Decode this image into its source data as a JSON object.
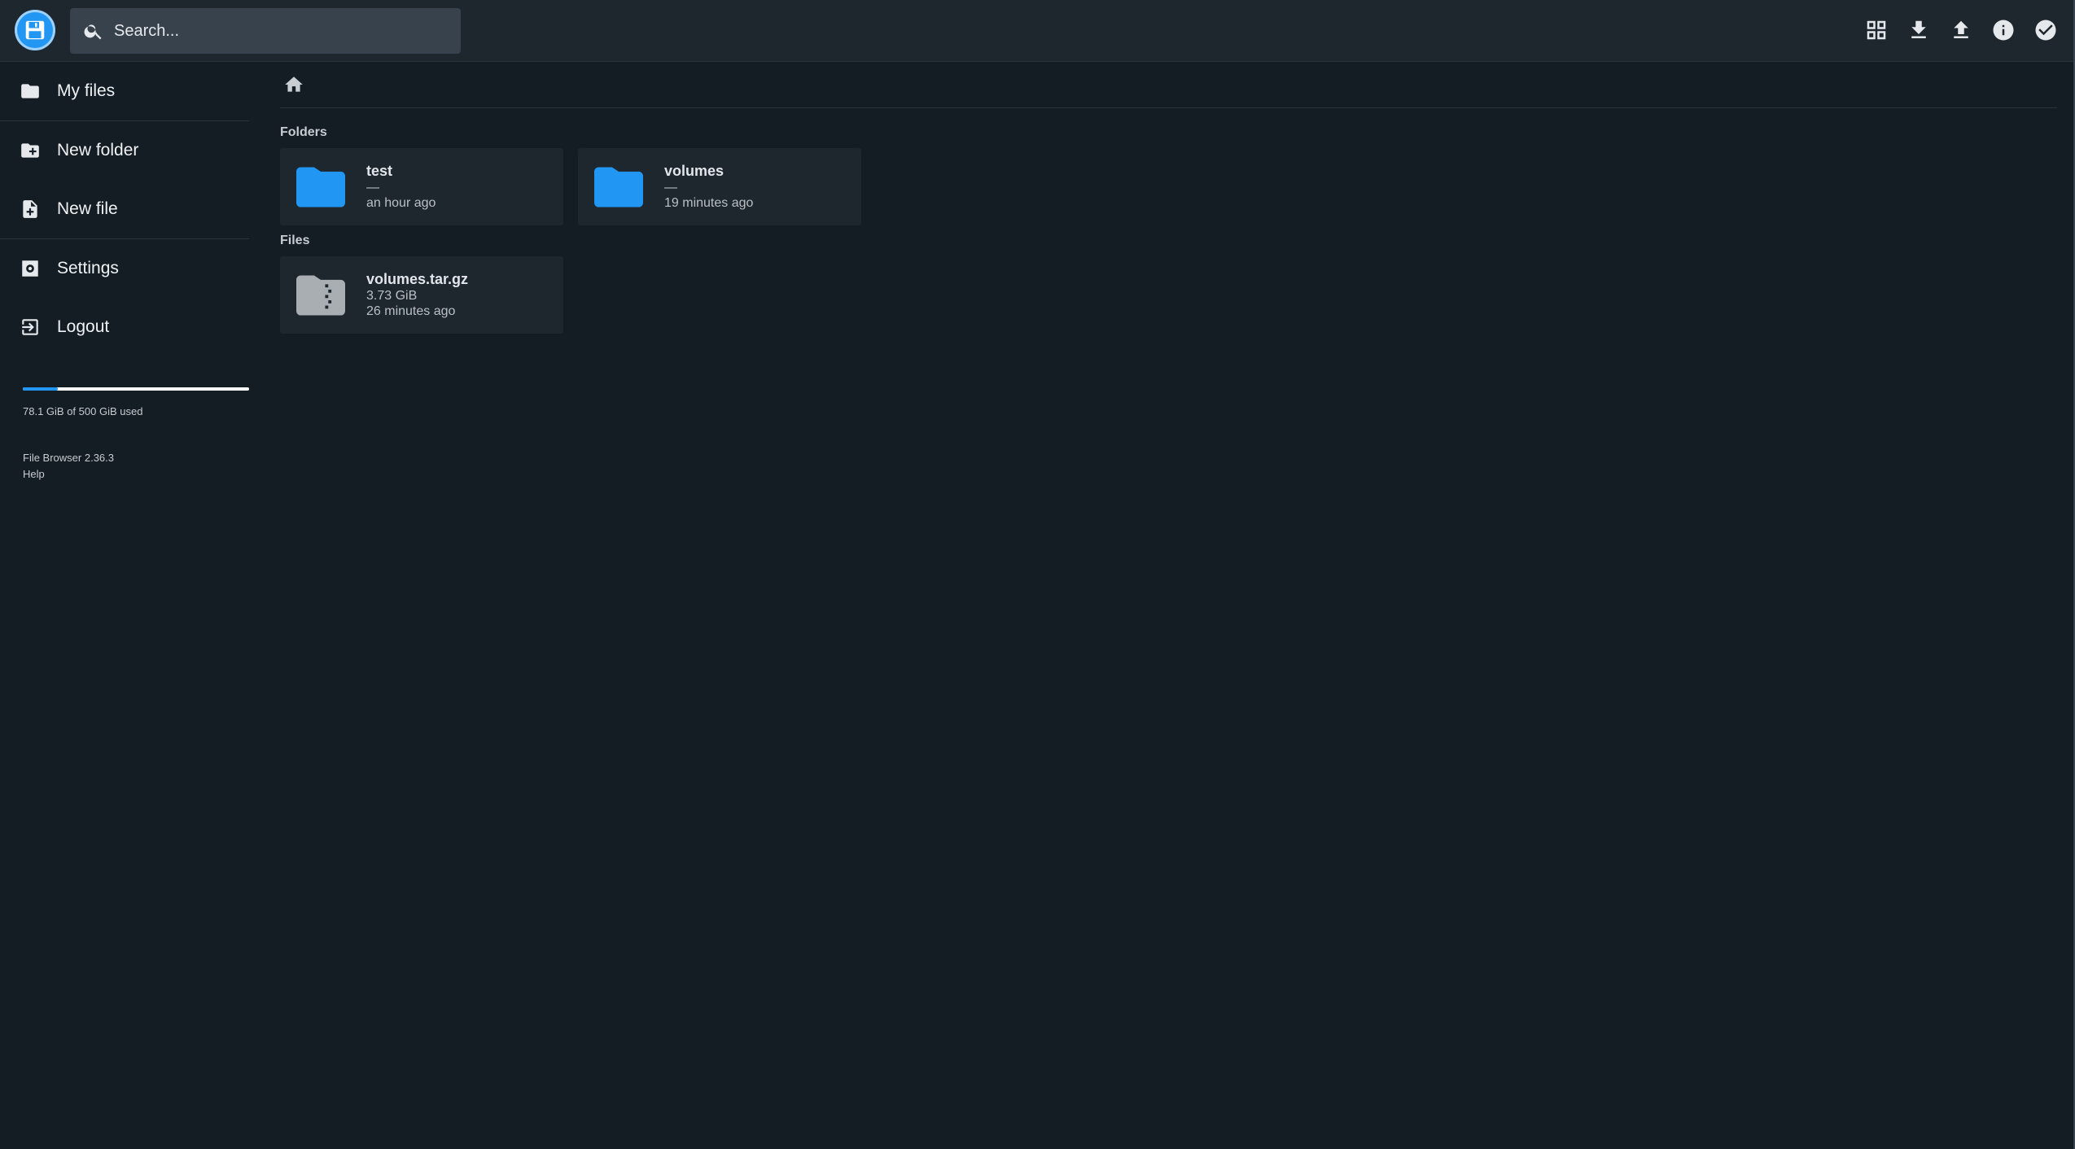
{
  "header": {
    "search_placeholder": "Search...",
    "actions": [
      {
        "name": "view-grid-icon"
      },
      {
        "name": "download-icon"
      },
      {
        "name": "upload-icon"
      },
      {
        "name": "info-icon"
      },
      {
        "name": "select-check-icon"
      }
    ]
  },
  "sidebar": {
    "items": [
      {
        "label": "My files",
        "icon": "folder-icon"
      },
      {
        "label": "New folder",
        "icon": "new-folder-icon"
      },
      {
        "label": "New file",
        "icon": "new-file-icon"
      },
      {
        "label": "Settings",
        "icon": "settings-icon"
      },
      {
        "label": "Logout",
        "icon": "logout-icon"
      }
    ],
    "quota": {
      "text": "78.1 GiB of 500 GiB used",
      "fraction": 0.156
    },
    "version": "File Browser 2.36.3",
    "help": "Help"
  },
  "main": {
    "breadcrumb_icon": "home-icon",
    "folders_title": "Folders",
    "folders": [
      {
        "name": "test",
        "size": "—",
        "modified": "an hour ago"
      },
      {
        "name": "volumes",
        "size": "—",
        "modified": "19 minutes ago"
      }
    ],
    "files_title": "Files",
    "files": [
      {
        "name": "volumes.tar.gz",
        "size": "3.73 GiB",
        "modified": "26 minutes ago"
      }
    ]
  },
  "colors": {
    "accent": "#2196f3",
    "background": "#141c24",
    "surface": "#1e262e",
    "archive_icon": "#a9aeb3"
  }
}
